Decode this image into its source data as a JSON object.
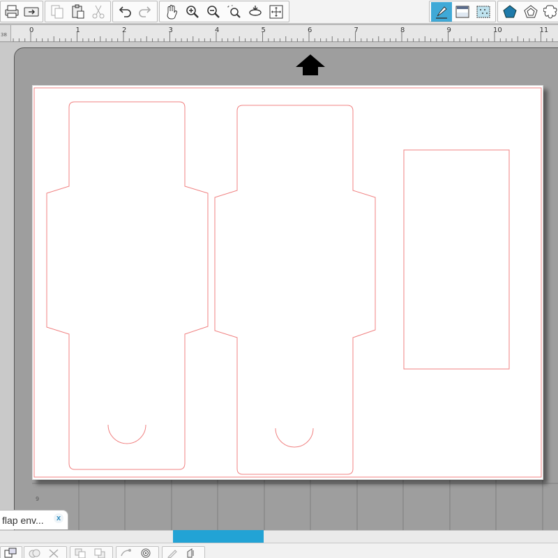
{
  "toolbar": {
    "groups": [
      {
        "name": "file",
        "items": [
          "print-icon",
          "send-to-cutter-icon"
        ]
      },
      {
        "name": "clipboard",
        "items": [
          "copy-icon",
          "paste-icon",
          "cut-icon"
        ]
      },
      {
        "name": "history",
        "items": [
          "undo-icon",
          "redo-icon"
        ]
      },
      {
        "name": "view",
        "items": [
          "pan-hand-icon",
          "zoom-in-icon",
          "zoom-out-icon",
          "zoom-selected-icon",
          "zoom-to-fit-icon",
          "fit-to-window-icon"
        ]
      },
      {
        "name": "panels",
        "items": [
          "line-style-icon",
          "fill-color-icon",
          "fill-pattern-icon"
        ],
        "active": "line-style-icon"
      },
      {
        "name": "shapes",
        "items": [
          "pentagon-icon",
          "offset-shape-icon",
          "flower-shape-icon"
        ]
      }
    ],
    "accent_color": "#3fa9d7"
  },
  "ruler": {
    "corner_label": "38",
    "ticks": [
      "0",
      "1",
      "2",
      "3",
      "4",
      "5",
      "6",
      "7",
      "8",
      "9",
      "10",
      "11"
    ],
    "unit": "inches"
  },
  "canvas": {
    "feed_direction_icon": "up-arrow-icon",
    "mat_color": "#9e9e9e",
    "page_color": "#ffffff",
    "cut_line_color": "#f08080",
    "shapes": [
      "envelope-template-left",
      "envelope-template-middle",
      "rectangle-card"
    ]
  },
  "document_tab": {
    "label": "flap env...",
    "close_icon": "close-icon"
  },
  "scrollbar": {
    "thumb_color": "#22a3d5"
  },
  "bottom_toolbar": {
    "groups": [
      {
        "name": "arrange",
        "items": [
          "group-icon"
        ]
      },
      {
        "name": "edit",
        "items": [
          "weld-icon",
          "delete-icon"
        ]
      },
      {
        "name": "align",
        "items": [
          "bring-forward-icon",
          "send-backward-icon"
        ]
      },
      {
        "name": "modify",
        "items": [
          "replicate-icon",
          "offset-icon"
        ]
      },
      {
        "name": "tools",
        "items": [
          "knife-icon",
          "trace-icon"
        ]
      }
    ]
  }
}
